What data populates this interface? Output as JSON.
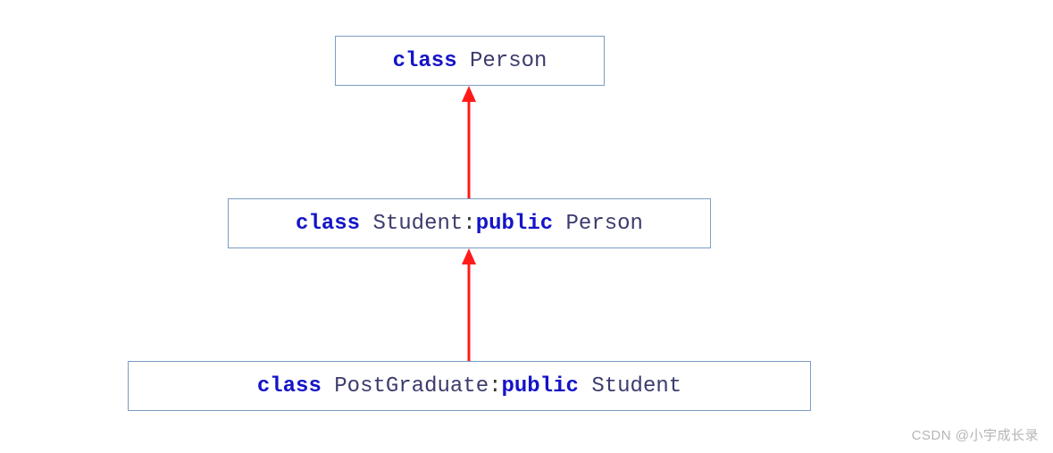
{
  "keyword": "class",
  "access": "public",
  "sep_inherit": ":",
  "boxes": {
    "top": {
      "name": "Person",
      "extends": null
    },
    "mid": {
      "name": "Student",
      "extends": "Person"
    },
    "bot": {
      "name": "PostGraduate",
      "extends": "Student"
    }
  },
  "watermark": "CSDN @小宇成长录"
}
